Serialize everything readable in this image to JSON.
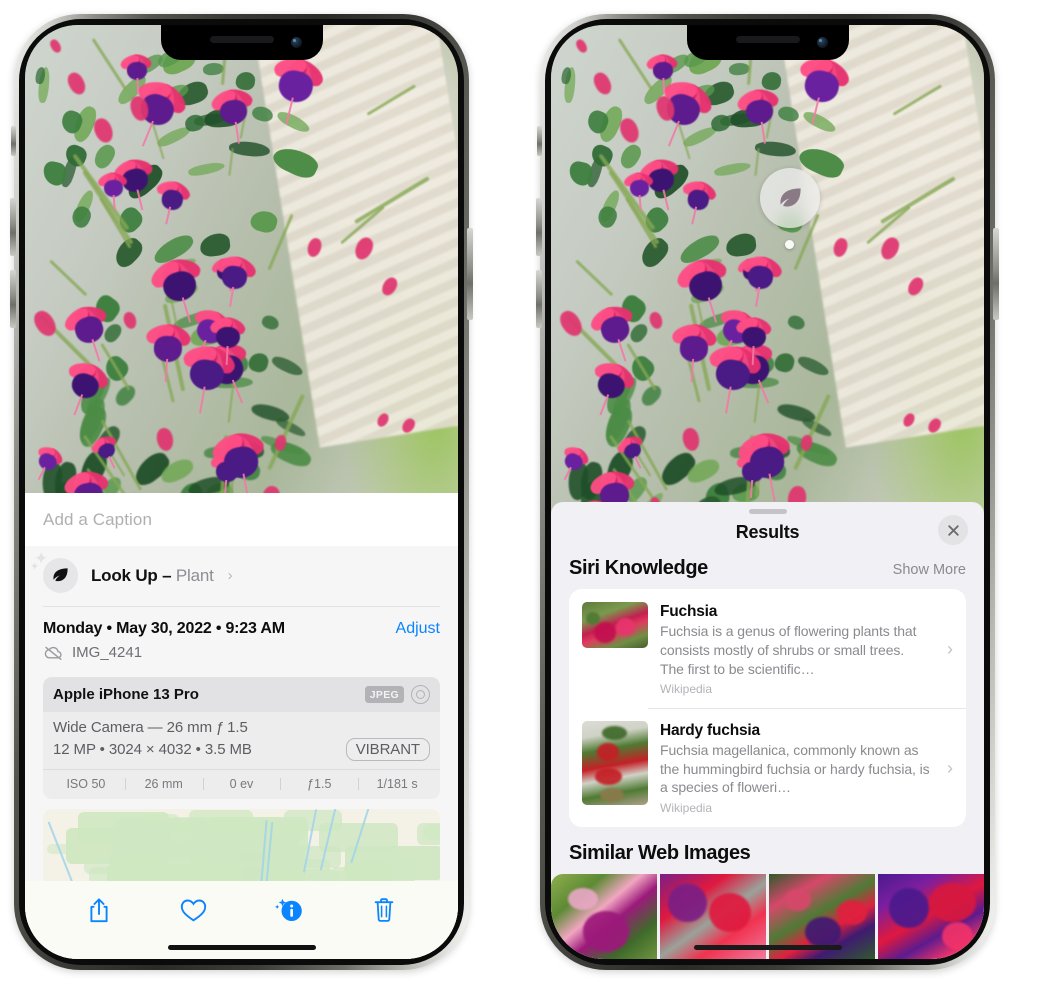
{
  "left_phone": {
    "photo": {
      "alt_name": "fuchsia-flowers-photo"
    },
    "caption_placeholder": "Add a Caption",
    "lookup": {
      "icon": "leaf-icon",
      "label": "Look Up – ",
      "subject": "Plant",
      "chevron": "›"
    },
    "metadata": {
      "date": "Monday • May 30, 2022 • 9:23 AM",
      "adjust_label": "Adjust",
      "cloud_icon": "cloud-slash-icon",
      "filename": "IMG_4241"
    },
    "camera": {
      "device": "Apple iPhone 13 Pro",
      "format_badge": "JPEG",
      "aperture_icon": "aperture-icon",
      "lens_line": "Wide Camera — 26 mm ƒ 1.5",
      "size_line": "12 MP • 3024 × 4032 • 3.5 MB",
      "style_badge": "VIBRANT",
      "exif": [
        "ISO 50",
        "26 mm",
        "0 ev",
        "ƒ1.5",
        "1/181 s"
      ]
    },
    "toolbar": [
      {
        "name": "share-button",
        "icon": "share-icon"
      },
      {
        "name": "favorite-button",
        "icon": "heart-icon"
      },
      {
        "name": "info-button",
        "icon": "info-sparkle-icon"
      },
      {
        "name": "delete-button",
        "icon": "trash-icon"
      }
    ]
  },
  "right_phone": {
    "badge": {
      "icon": "leaf-icon",
      "name": "visual-look-up-badge"
    },
    "sheet": {
      "title": "Results",
      "close_icon": "close-icon",
      "siri_section": {
        "title": "Siri Knowledge",
        "show_more": "Show More",
        "items": [
          {
            "title": "Fuchsia",
            "desc": "Fuchsia is a genus of flowering plants that consists mostly of shrubs or small trees. The first to be scientific…",
            "source": "Wikipedia",
            "chevron": "›"
          },
          {
            "title": "Hardy fuchsia",
            "desc": "Fuchsia magellanica, commonly known as the hummingbird fuchsia or hardy fuchsia, is a species of floweri…",
            "source": "Wikipedia",
            "chevron": "›"
          }
        ]
      },
      "similar_section": {
        "title": "Similar Web Images",
        "thumbs": [
          "web-image-1",
          "web-image-2",
          "web-image-3",
          "web-image-4"
        ]
      }
    }
  },
  "colors": {
    "accent_blue": "#0a84ff",
    "sheet_bg": "#f1f0f4",
    "card_bg": "#ffffff",
    "secondary_text": "#8a8a8f"
  }
}
